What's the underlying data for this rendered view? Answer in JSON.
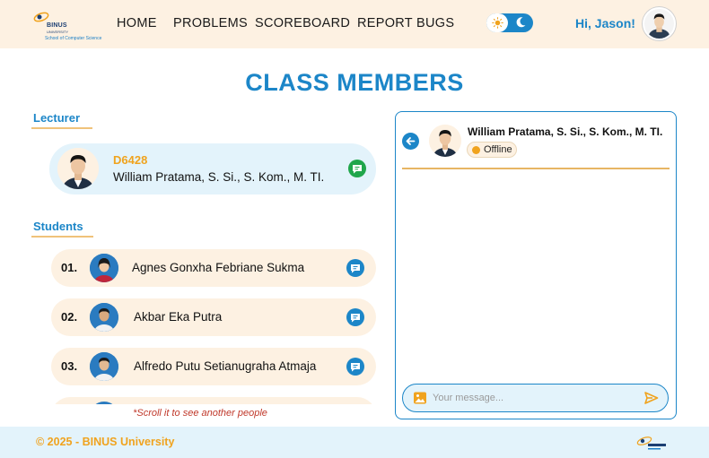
{
  "header": {
    "logo": {
      "brand": "BINUS",
      "sub": "UNIVERSITY",
      "school": "School of Computer Science"
    },
    "nav": [
      "HOME",
      "PROBLEMS",
      "SCOREBOARD",
      "REPORT BUGS"
    ],
    "greeting": "Hi, Jason!"
  },
  "page_title": "CLASS MEMBERS",
  "lecturer_section": {
    "label": "Lecturer",
    "code": "D6428",
    "name": "William Pratama, S. Si., S. Kom., M. TI."
  },
  "students_section": {
    "label": "Students",
    "students": [
      {
        "number": "01.",
        "name": "Agnes Gonxha Febriane Sukma"
      },
      {
        "number": "02.",
        "name": "Akbar Eka Putra"
      },
      {
        "number": "03.",
        "name": "Alfredo Putu Setianugraha Atmaja"
      }
    ],
    "scroll_hint": "*Scroll it to see another people"
  },
  "chat": {
    "name": "William Pratama, S. Si., S. Kom., M. TI.",
    "status": "Offline",
    "placeholder": "Your message..."
  },
  "footer": {
    "text": "© 2025 - BINUS University"
  },
  "colors": {
    "primary": "#1c86c8",
    "accent": "#f0a31e",
    "header_bg": "#fdf1e2",
    "footer_bg": "#e3f3fb",
    "lecturer_card_bg": "#e3f3fb",
    "student_row_bg": "#fdf1e2",
    "hint": "#c0392b"
  }
}
